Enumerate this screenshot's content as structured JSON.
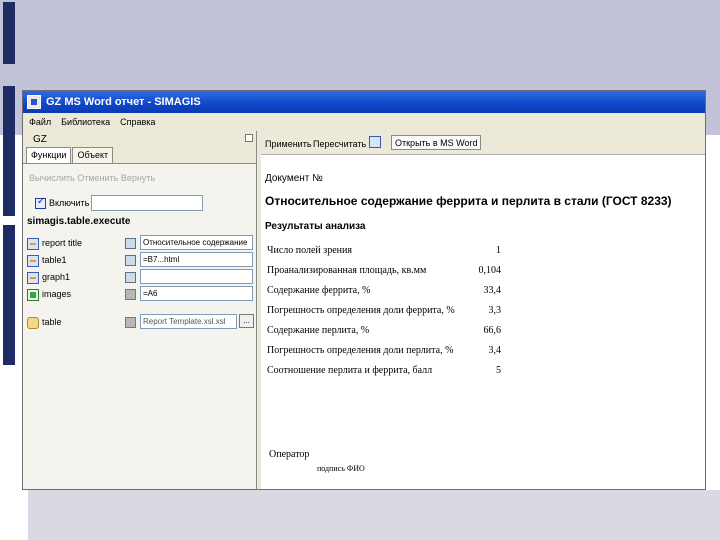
{
  "window": {
    "title": "GZ MS Word отчет - SIMAGIS"
  },
  "menu": [
    "Файл",
    "Библиотека",
    "Справка"
  ],
  "left_panel": {
    "header_label": "GZ",
    "tabs": [
      "Функции",
      "Объект"
    ],
    "links": "Вычислить  Отменить  Вернуть",
    "checkbox_label": "Включить",
    "checkbox_value": "",
    "exec_title": "simagis.table.execute",
    "params": [
      {
        "label": "report title",
        "value": "Относительное содержание"
      },
      {
        "label": "table1",
        "value": "=B7...html"
      },
      {
        "label": "graph1",
        "value": ""
      },
      {
        "label": "images",
        "value": "=A6"
      },
      {
        "label": "table",
        "value": "Report Template.xsl.xsl"
      }
    ],
    "dots_label": "..."
  },
  "right_panel": {
    "toolbar": {
      "apply": "Применить",
      "recalc": "Пересчитать",
      "open_word": "Открыть в MS Word"
    },
    "doc_no": "Документ №",
    "doc_title": "Относительное содержание феррита и перлита в стали (ГОСТ 8233)",
    "results_title": "Результаты анализа",
    "rows": [
      {
        "label": "Число полей зрения",
        "value": "1"
      },
      {
        "label": "Проанализированная площадь, кв.мм",
        "value": "0,104"
      },
      {
        "label": "Содержание феррита, %",
        "value": "33,4"
      },
      {
        "label": "Погрешность определения доли феррита, %",
        "value": "3,3"
      },
      {
        "label": "Содержание перлита, %",
        "value": "66,6"
      },
      {
        "label": "Погрешность определения доли перлита, %",
        "value": "3,4"
      },
      {
        "label": "Соотношение перлита и феррита, балл",
        "value": "5"
      }
    ],
    "operator": "Оператор",
    "signature": "подпись   ФИО"
  }
}
